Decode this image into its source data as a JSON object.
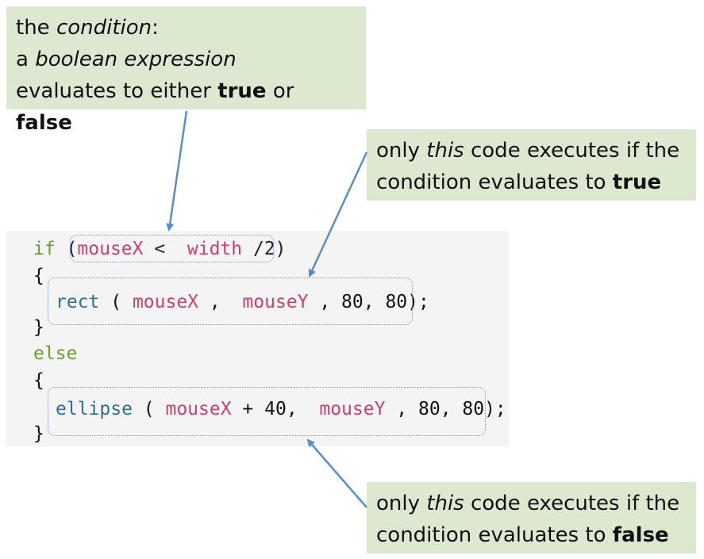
{
  "callouts": {
    "top": {
      "l1_a": "the ",
      "l1_b": "condition",
      "l1_c": ":",
      "l2_a": "a ",
      "l2_b": "boolean expression",
      "l3_a": "evaluates to either ",
      "l3_b": "true",
      "l3_c": " or ",
      "l3_d": "false"
    },
    "true_case": {
      "l1_a": "only ",
      "l1_b": "this",
      "l1_c": " code executes if the",
      "l2_a": "condition evaluates to ",
      "l2_b": "true"
    },
    "false_case": {
      "l1_a": "only ",
      "l1_b": "this",
      "l1_c": " code executes if the",
      "l2_a": "condition evaluates to ",
      "l2_b": "false"
    }
  },
  "code": {
    "line1": {
      "kw": "if",
      "open": " (",
      "v1": "mouseX",
      "op": " <  ",
      "v2": "width",
      "rest": " /2)"
    },
    "line2": {
      "text": "{"
    },
    "line3": {
      "fn": "rect",
      "p1": " ( ",
      "v1": "mouseX",
      "p2": " ,  ",
      "v2": "mouseY",
      "p3": " , 80, 80);"
    },
    "line4": {
      "text": "}"
    },
    "line5": {
      "kw": "else"
    },
    "line6": {
      "text": "{"
    },
    "line7": {
      "fn": "ellipse",
      "p1": " ( ",
      "v1": "mouseX",
      "p2": " + 40,  ",
      "v2": "mouseY",
      "p3": " , 80, 80);"
    },
    "line8": {
      "text": "}"
    }
  },
  "colors": {
    "callout_bg": "#dce8cf",
    "keyword": "#6f9a2e",
    "function": "#2f6f96",
    "variable": "#cc3f73",
    "arrow": "#5b8ec2",
    "dashed_box": "#7b8fd8"
  }
}
